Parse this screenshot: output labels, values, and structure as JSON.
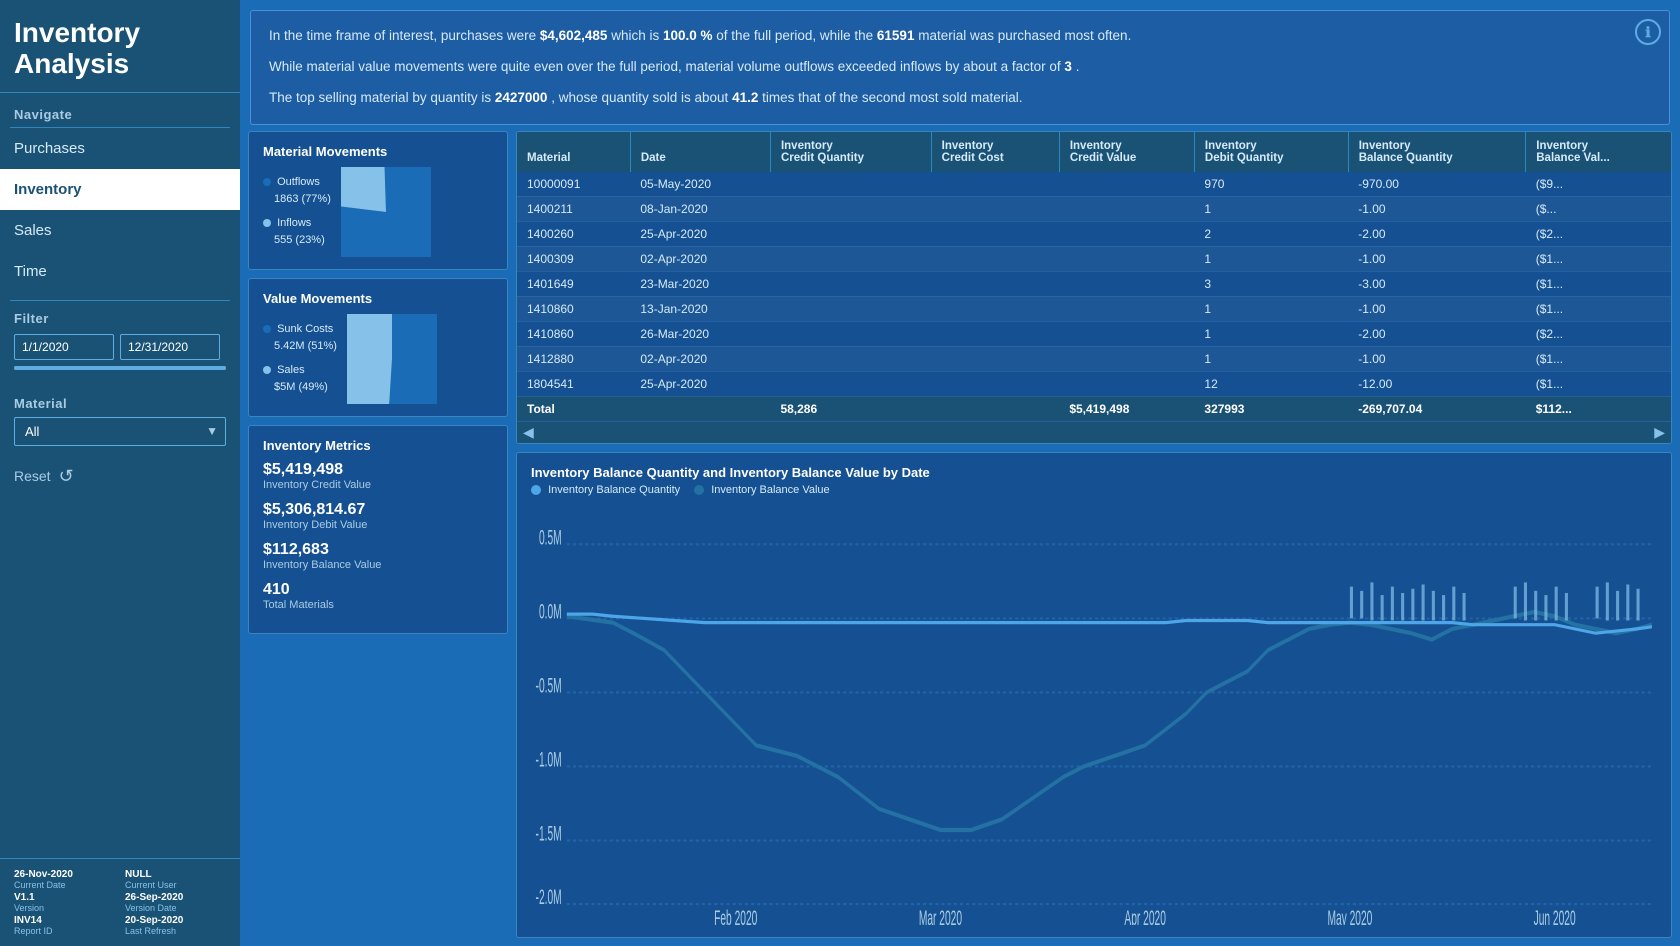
{
  "app": {
    "title_line1": "Inventory",
    "title_line2": "Analysis",
    "info_icon": "ℹ"
  },
  "sidebar": {
    "navigate_label": "Navigate",
    "nav_items": [
      {
        "label": "Purchases",
        "active": false
      },
      {
        "label": "Inventory",
        "active": true
      },
      {
        "label": "Sales",
        "active": false
      },
      {
        "label": "Time",
        "active": false
      }
    ],
    "filter_label": "Filter",
    "date_start": "1/1/2020",
    "date_end": "12/31/2020",
    "material_label": "Material",
    "material_value": "All",
    "reset_label": "Reset",
    "footer": {
      "current_date_val": "26-Nov-2020",
      "current_date_key": "Current Date",
      "current_user_val": "NULL",
      "current_user_key": "Current User",
      "version_val": "V1.1",
      "version_key": "Version",
      "version_date_val": "26-Sep-2020",
      "version_date_key": "Version Date",
      "report_id_val": "INV14",
      "report_id_key": "Report ID",
      "last_refresh_val": "20-Sep-2020",
      "last_refresh_key": "Last Refresh"
    }
  },
  "banner": {
    "text1": "In the time frame of interest, purchases were ",
    "purchases_value": "$4,602,485",
    "text2": " which is ",
    "pct_value": "100.0 %",
    "text3": " of the full period, while the ",
    "material_num": "61591",
    "text4": " material was purchased most often.",
    "text5": "While material value movements were quite even over the full period, material volume outflows exceeded inflows by about a factor of ",
    "factor": "3",
    "text6": ".",
    "text7": "The top selling material by quantity is ",
    "top_material": "2427000",
    "text8": ", whose quantity sold is about ",
    "times_val": "41.2",
    "text9": " times that of the second most sold material."
  },
  "material_movements": {
    "title": "Material Movements",
    "outflows_label": "Outflows",
    "outflows_value": "1863 (77%)",
    "inflows_label": "Inflows",
    "inflows_value": "555 (23%)",
    "outflows_pct": 77,
    "inflows_pct": 23
  },
  "value_movements": {
    "title": "Value Movements",
    "sunk_label": "Sunk Costs",
    "sunk_value": "5.42M (51%)",
    "sales_label": "Sales",
    "sales_value": "$5M (49%)",
    "sunk_pct": 51,
    "sales_pct": 49
  },
  "inventory_metrics": {
    "title": "Inventory Metrics",
    "credit_value_val": "$5,419,498",
    "credit_value_label": "Inventory Credit Value",
    "debit_value_val": "$5,306,814.67",
    "debit_value_label": "Inventory Debit Value",
    "balance_value_val": "$112,683",
    "balance_value_label": "Inventory Balance Value",
    "total_materials_val": "410",
    "total_materials_label": "Total Materials"
  },
  "table": {
    "columns": [
      "Material",
      "Date",
      "Inventory\nCredit Quantity",
      "Inventory\nCredit Cost",
      "Inventory\nCredit Value",
      "Inventory\nDebit Quantity",
      "Inventory\nBalance Quantity",
      "Inventory\nBalance Val..."
    ],
    "rows": [
      [
        "10000091",
        "05-May-2020",
        "",
        "",
        "",
        "970",
        "-970.00",
        "($9..."
      ],
      [
        "1400211",
        "08-Jan-2020",
        "",
        "",
        "",
        "1",
        "-1.00",
        "($..."
      ],
      [
        "1400260",
        "25-Apr-2020",
        "",
        "",
        "",
        "2",
        "-2.00",
        "($2..."
      ],
      [
        "1400309",
        "02-Apr-2020",
        "",
        "",
        "",
        "1",
        "-1.00",
        "($1..."
      ],
      [
        "1401649",
        "23-Mar-2020",
        "",
        "",
        "",
        "3",
        "-3.00",
        "($1..."
      ],
      [
        "1410860",
        "13-Jan-2020",
        "",
        "",
        "",
        "1",
        "-1.00",
        "($1..."
      ],
      [
        "1410860",
        "26-Mar-2020",
        "",
        "",
        "",
        "1",
        "-2.00",
        "($2..."
      ],
      [
        "1412880",
        "02-Apr-2020",
        "",
        "",
        "",
        "1",
        "-1.00",
        "($1..."
      ],
      [
        "1804541",
        "25-Apr-2020",
        "",
        "",
        "",
        "12",
        "-12.00",
        "($1..."
      ]
    ],
    "total_row": [
      "Total",
      "",
      "58,286",
      "",
      "$5,419,498",
      "327993",
      "-269,707.04",
      "$112..."
    ]
  },
  "chart": {
    "title": "Inventory Balance Quantity and Inventory Balance Value by Date",
    "legend_qty": "Inventory Balance Quantity",
    "legend_val": "Inventory Balance Value",
    "x_labels": [
      "Feb 2020",
      "Mar 2020",
      "Apr 2020",
      "May 2020",
      "Jun 2020"
    ],
    "y_labels": [
      "0.5M",
      "0.0M",
      "-0.5M",
      "-1.0M",
      "-1.5M",
      "-2.0M"
    ],
    "qty_color": "#4da6e8",
    "val_color": "#2471a3"
  }
}
